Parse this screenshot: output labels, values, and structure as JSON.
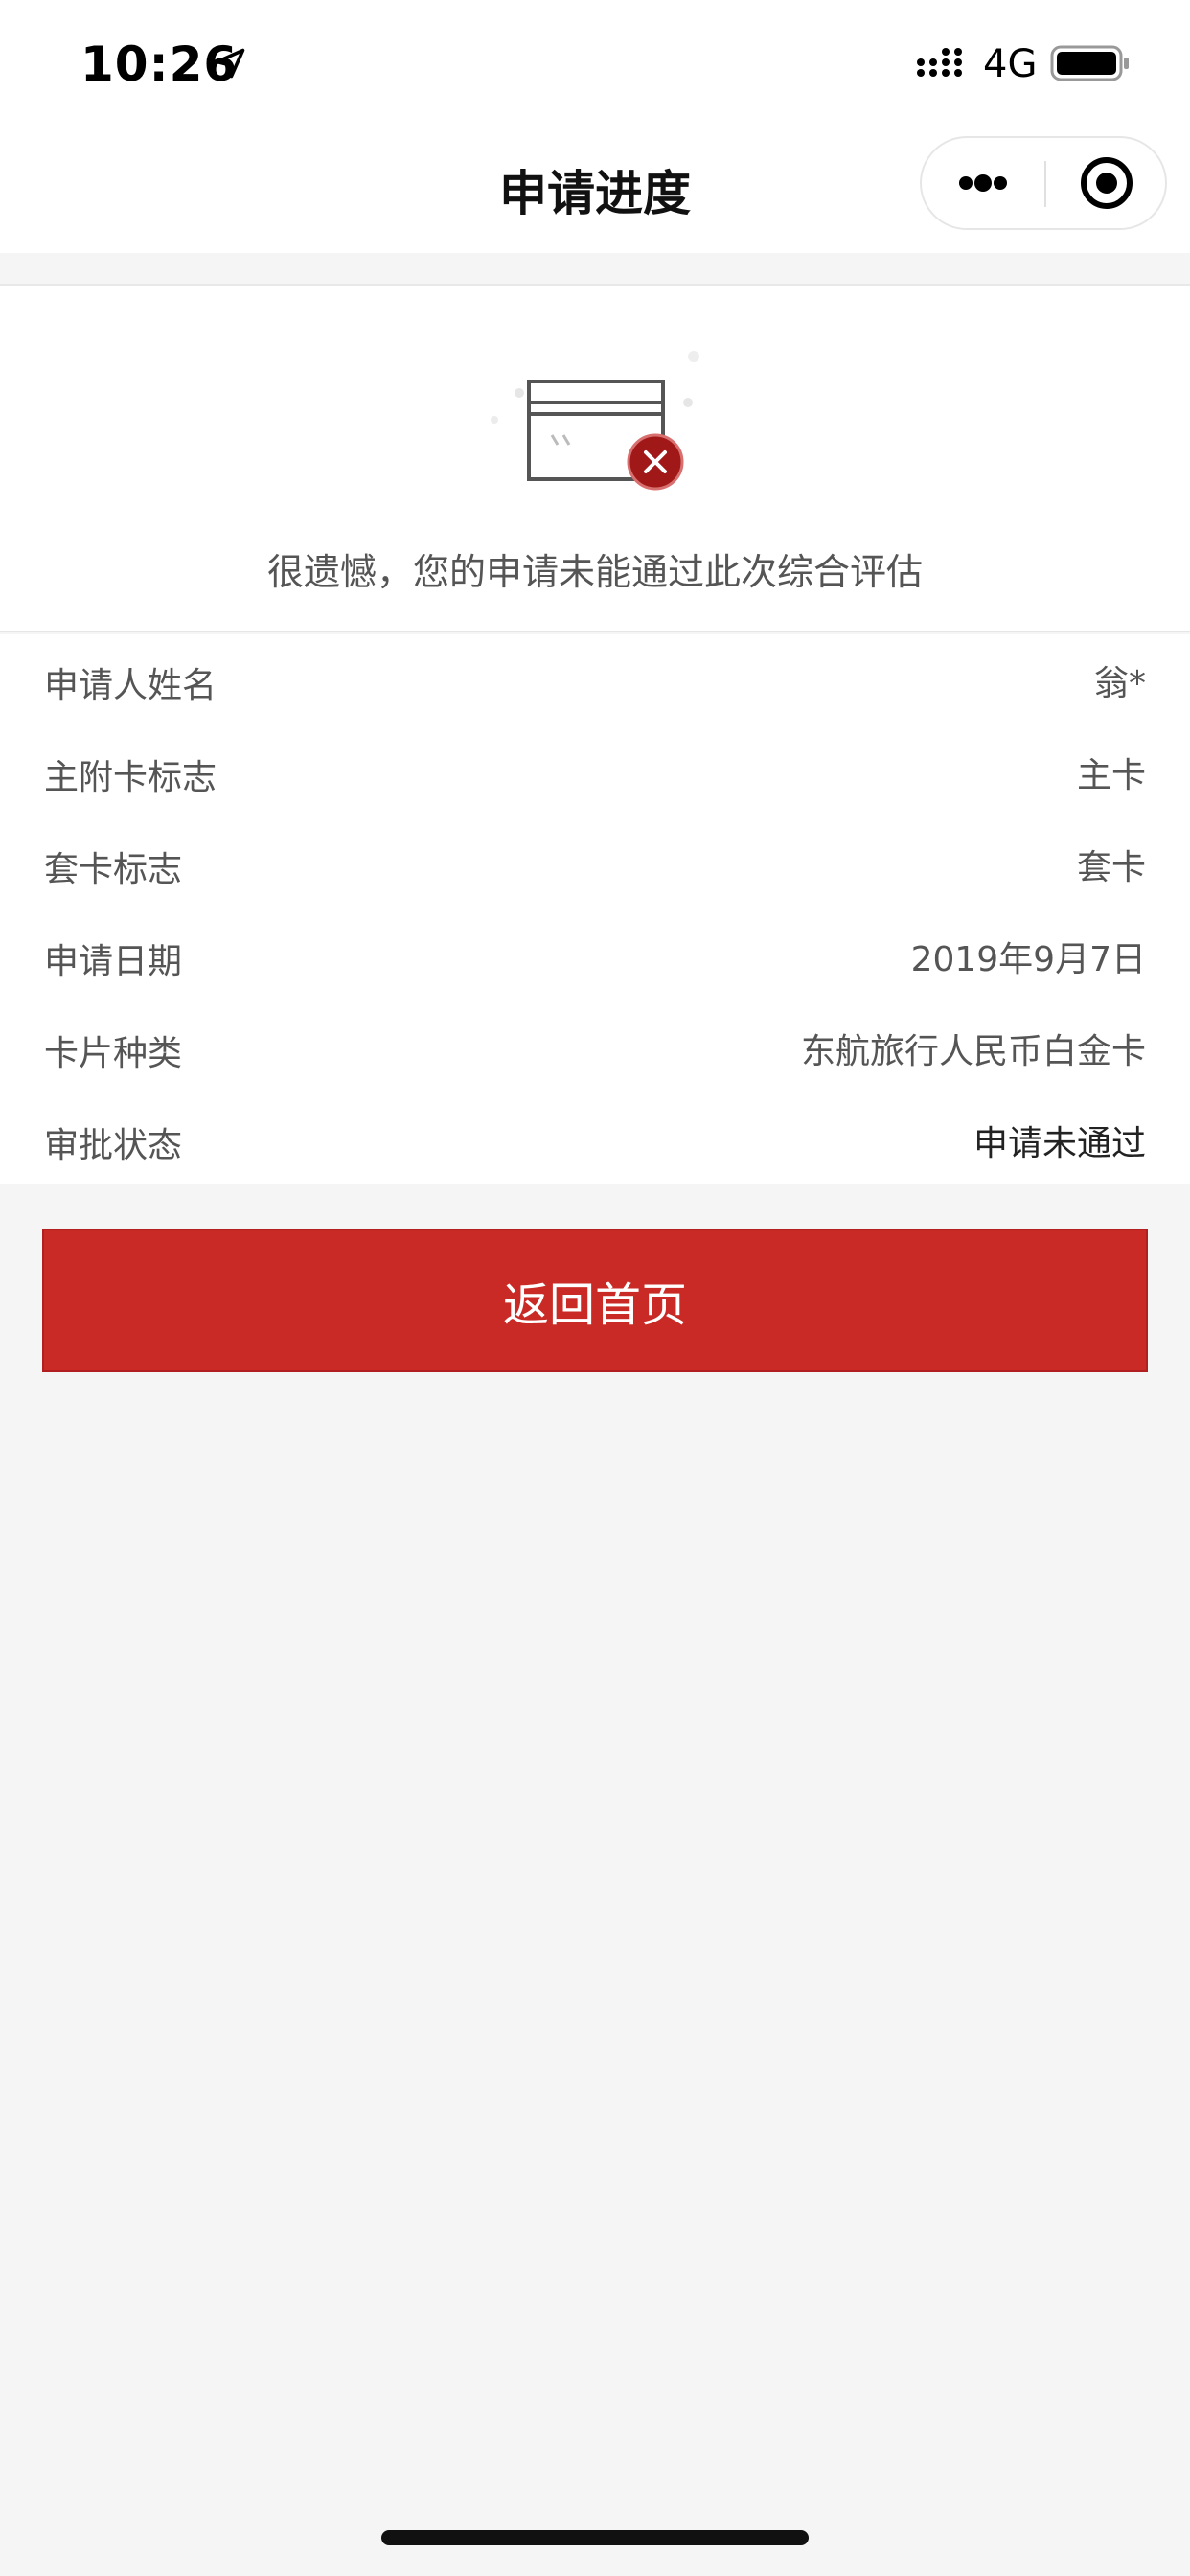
{
  "status_bar": {
    "time": "10:26",
    "network": "4G",
    "icons": [
      "location-arrow-icon",
      "signal-icon",
      "battery-icon"
    ]
  },
  "nav": {
    "title": "申请进度",
    "icons": [
      "more-dots-icon",
      "close-target-icon"
    ]
  },
  "result": {
    "icon": "card-rejected-icon",
    "message": "很遗憾，您的申请未能通过此次综合评估"
  },
  "info": {
    "rows": [
      {
        "label": "申请人姓名",
        "value": "翁*"
      },
      {
        "label": "主附卡标志",
        "value": "主卡"
      },
      {
        "label": "套卡标志",
        "value": "套卡"
      },
      {
        "label": "申请日期",
        "value": "2019年9月7日"
      },
      {
        "label": "卡片种类",
        "value": "东航旅行人民币白金卡"
      },
      {
        "label": "审批状态",
        "value": "申请未通过"
      }
    ]
  },
  "actions": {
    "home_label": "返回首页"
  },
  "colors": {
    "accent": "#c92a25",
    "background": "#f5f5f5",
    "card": "#ffffff"
  }
}
